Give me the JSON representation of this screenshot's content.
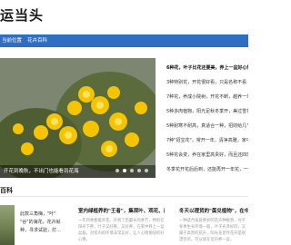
{
  "site": {
    "brand": "运当头"
  },
  "nav": {
    "items": [
      "当前位置",
      "花卉百科"
    ]
  },
  "slider": {
    "caption": "开花到晚秋，不出门也能看到花海",
    "dots": 5,
    "active_dot": 1
  },
  "news": {
    "items": [
      "6种花，叶子比花还要美，养上一盆好心情",
      "3种特别花，开花很好看，只是名称不看",
      "7种花，养成小院树，开花不断，越养一年",
      "5种多肉植物，阳光足秋冬季开，美过雪花",
      "5种耐寒不耐高，真适合一种，招财给几千",
      "7种\"招宝花\"，常开一年，清净高雅，家中",
      "5种花会变，养在家里高贵好，而且还四季开",
      "冬季花开花后后到，还能再开一年花，一年"
    ],
    "bold_index": 0
  },
  "section": {
    "title": "百科"
  },
  "cards": [
    {
      "lines": [
        "此款三角梅，\"叶\"",
        "\"谷\"的海花，花卉就",
        "种，寻求试验，打…"
      ]
    },
    {
      "title": "室内绿植养的\"王者\"，集观叶、观花、阅香…",
      "desc": "一年四季都能开花，开到了后最长的季节，特别在阳光下养，叶子又好看，又好养，在家中养上一盆盆栽，对室内的环境非常友好，让人心情愉快的好心情。"
    },
    {
      "title": "冬天以理货的\"蛋兑植物\"，在中开…",
      "desc": "一种适合家庭养护的花卉种植到，对于冬季生长环境一般，叶子光泽好的，又属于高贵的花卉，阳光充足时花开是很漂亮的，可以放在室内养一盆。"
    }
  ],
  "colors": {
    "nav_bg": "#2f6ec0",
    "brand_text": "#1a1a1a"
  }
}
